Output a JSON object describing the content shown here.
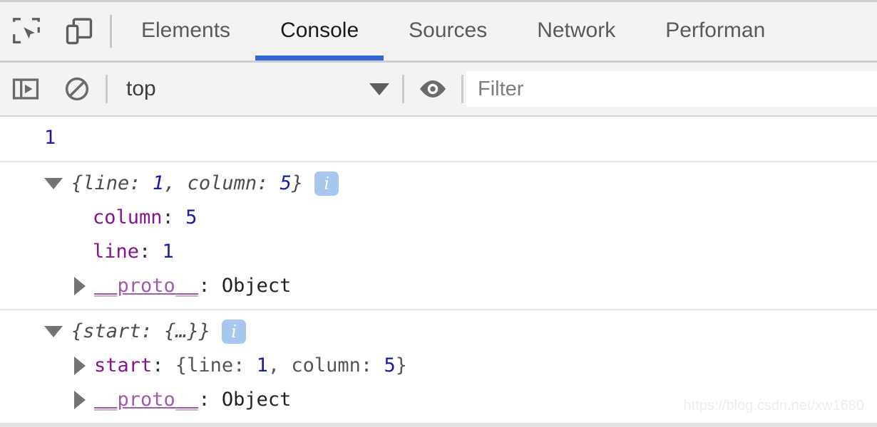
{
  "devtools": {
    "toolbar": {
      "inspect_icon": "inspect-element-icon",
      "device_icon": "device-toolbar-icon",
      "tabs": [
        {
          "label": "Elements",
          "active": false
        },
        {
          "label": "Console",
          "active": true
        },
        {
          "label": "Sources",
          "active": false
        },
        {
          "label": "Network",
          "active": false
        },
        {
          "label": "Performan",
          "active": false
        }
      ],
      "active_tab_color": "#3367d6"
    },
    "filterbar": {
      "sidebar_icon": "console-sidebar-icon",
      "clear_icon": "clear-console-icon",
      "context_value": "top",
      "caret_icon": "chevron-down-icon",
      "eye_icon": "eye-icon",
      "filter_placeholder": "Filter",
      "filter_value": ""
    },
    "console": {
      "messages": [
        {
          "type": "number-result",
          "value": "1",
          "color": "#1a1aa6"
        },
        {
          "type": "object",
          "expanded": true,
          "preview": "{line: 1, column: 5}",
          "preview_parts": {
            "open": "{",
            "k1": "line: ",
            "v1": "1",
            "sep": ", ",
            "k2": "column: ",
            "v2": "5",
            "close": "}"
          },
          "badge": "i",
          "properties": [
            {
              "key": "column",
              "sep": ": ",
              "value": "5",
              "value_kind": "number",
              "expandable": false
            },
            {
              "key": "line",
              "sep": ": ",
              "value": "1",
              "value_kind": "number",
              "expandable": false
            },
            {
              "key": "__proto__",
              "sep": ": ",
              "value": "Object",
              "value_kind": "object",
              "expandable": true
            }
          ]
        },
        {
          "type": "object",
          "expanded": true,
          "preview": "{start: {…}}",
          "preview_parts": {
            "open": "{",
            "k1": "start: ",
            "v1": "{…}",
            "close": "}"
          },
          "badge": "i",
          "properties": [
            {
              "key": "start",
              "sep": ": ",
              "value": "{line: 1, column: 5}",
              "value_kind": "preview",
              "expandable": true,
              "value_parts": {
                "open": "{",
                "k1": "line: ",
                "v1": "1",
                "sep": ", ",
                "k2": "column: ",
                "v2": "5",
                "close": "}"
              }
            },
            {
              "key": "__proto__",
              "sep": ": ",
              "value": "Object",
              "value_kind": "object",
              "expandable": true
            }
          ]
        }
      ]
    },
    "watermark": "https://blog.csdn.net/xw1680"
  }
}
